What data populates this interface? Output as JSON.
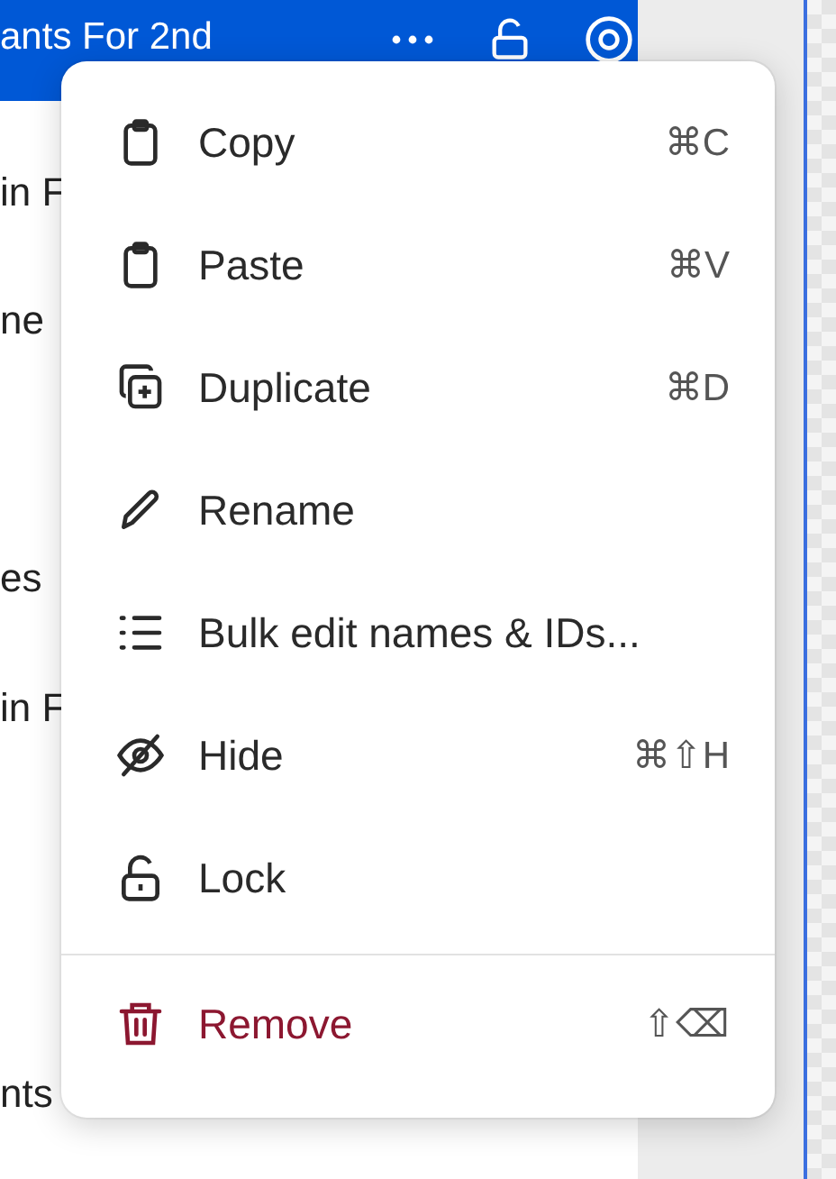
{
  "header": {
    "title": "ants For 2nd"
  },
  "layers": [
    "in F",
    "ne",
    "es",
    "in F",
    "nts"
  ],
  "menu": {
    "items": [
      {
        "kind": "normal",
        "label": "Copy",
        "shortcut": "⌘C"
      },
      {
        "kind": "normal",
        "label": "Paste",
        "shortcut": "⌘V"
      },
      {
        "kind": "normal",
        "label": "Duplicate",
        "shortcut": "⌘D"
      },
      {
        "kind": "normal",
        "label": "Rename"
      },
      {
        "kind": "normal",
        "label": "Bulk edit names & IDs..."
      },
      {
        "kind": "normal",
        "label": "Hide",
        "shortcut": "⌘⇧H"
      },
      {
        "kind": "normal",
        "label": "Lock"
      },
      {
        "kind": "danger",
        "label": "Remove",
        "shortcut": "⇧⌫"
      }
    ]
  }
}
